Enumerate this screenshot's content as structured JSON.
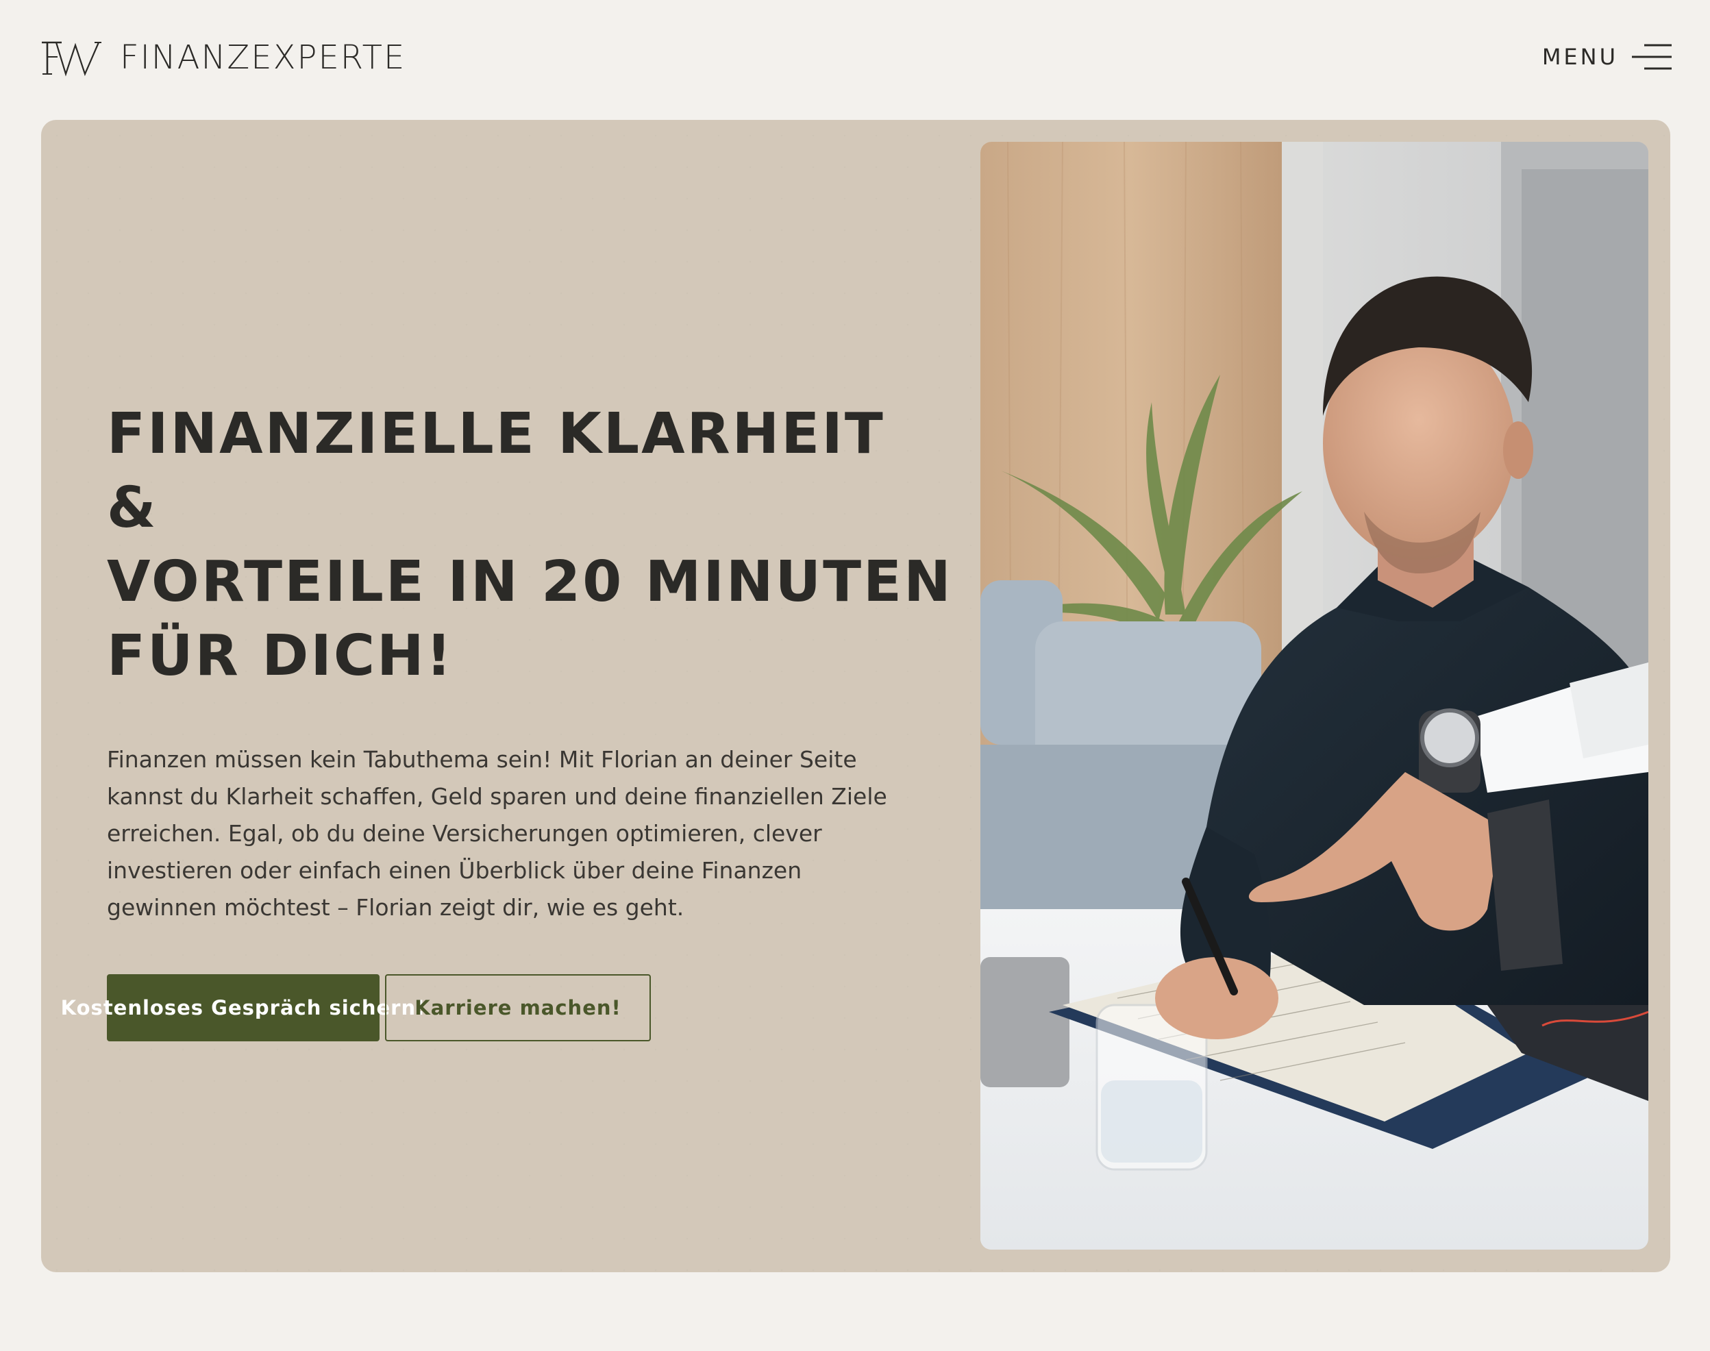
{
  "header": {
    "logo_mark": "FW",
    "brand": "FINANZEXPERTE",
    "menu_label": "MENU",
    "menu_icon": "hamburger-menu-icon"
  },
  "hero": {
    "headline": "FINANZIELLE KLARHEIT &\nVORTEILE IN 20 MINUTEN\nFÜR DICH!",
    "lead": "Finanzen müssen kein Tabuthema sein! Mit Florian an deiner Seite kannst du Klarheit schaffen, Geld sparen und deine finanziellen Ziele erreichen. Egal, ob du deine Versicherungen optimieren, clever investieren oder einfach einen Überblick über deine Finanzen gewinnen möchtest – Florian zeigt dir, wie es geht.",
    "primary_button": "Kostenloses Gespräch sichern!",
    "secondary_button": "Karriere machen!"
  },
  "colors": {
    "page_background": "#f3f1ed",
    "hero_background": "#d3c8b9",
    "accent_green": "#4a572a",
    "text": "#2b2a27"
  }
}
